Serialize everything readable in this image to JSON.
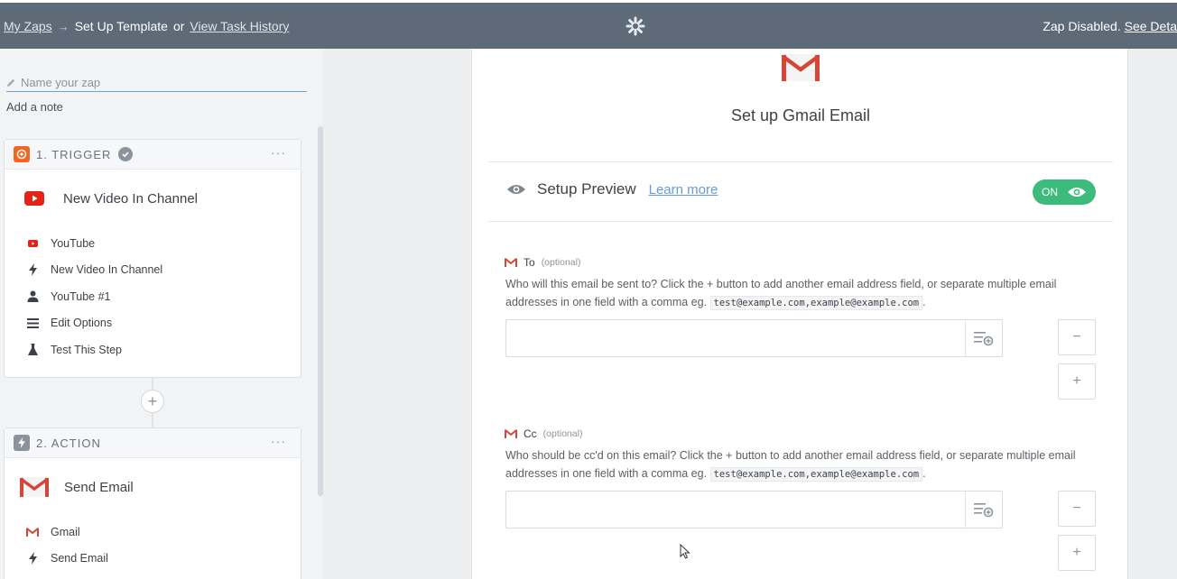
{
  "topbar": {
    "my_zaps": "My Zaps",
    "arrow": "→",
    "current": "Set Up Template",
    "or": "or",
    "history": "View Task History",
    "status": "Zap Disabled.",
    "see_details": "See Deta"
  },
  "sidebar": {
    "name_placeholder": "Name your zap",
    "add_note": "Add a note",
    "trigger": {
      "heading": "1. TRIGGER",
      "app_title": "New Video In Channel",
      "items": [
        "YouTube",
        "New Video In Channel",
        "YouTube #1",
        "Edit Options",
        "Test This Step"
      ]
    },
    "action": {
      "heading": "2. ACTION",
      "app_title": "Send Email",
      "items": [
        "Gmail",
        "Send Email"
      ]
    },
    "menu_dots": "···",
    "add_step": "+"
  },
  "panel": {
    "title": "Set up Gmail Email",
    "preview_label": "Setup Preview",
    "learn_more": "Learn more",
    "toggle_label": "ON",
    "fields": [
      {
        "label": "To",
        "optional": "(optional)",
        "help": "Who will this email be sent to? Click the + button to add another email address field, or separate multiple email addresses in one field with a comma eg.",
        "example": "test@example.com,example@example.com",
        "help_end": "."
      },
      {
        "label": "Cc",
        "optional": "(optional)",
        "help": "Who should be cc'd on this email? Click the + button to add another email address field, or separate multiple email addresses in one field with a comma eg.",
        "example": "test@example.com,example@example.com",
        "help_end": "."
      }
    ],
    "minus": "−",
    "plus": "+"
  },
  "colors": {
    "topbar": "#5e6a78",
    "accent_green": "#3dbb7d",
    "link_blue": "#6b9bd2",
    "youtube_red": "#e62117",
    "gmail_red": "#d44638",
    "trigger_orange": "#f26522"
  }
}
